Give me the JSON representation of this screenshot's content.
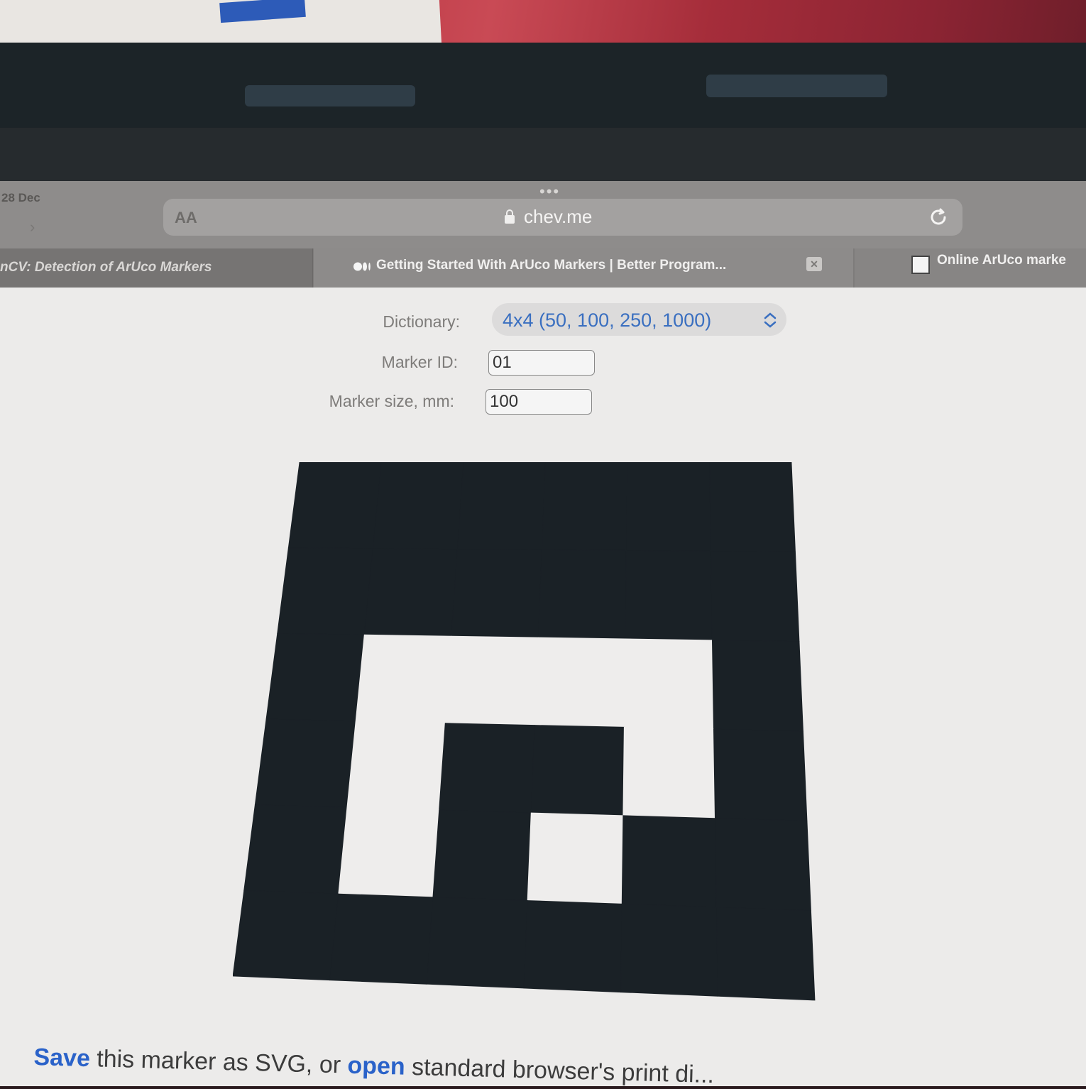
{
  "status": {
    "date": "28 Dec"
  },
  "browser": {
    "url": "chev.me",
    "text_size_label": "AA"
  },
  "tabs": [
    {
      "title": "nCV: Detection of ArUco Markers"
    },
    {
      "title": "Getting Started With ArUco Markers | Better Program..."
    },
    {
      "title": "Online ArUco marke"
    }
  ],
  "form": {
    "dictionary_label": "Dictionary:",
    "dictionary_value": "4x4 (50, 100, 250, 1000)",
    "marker_id_label": "Marker ID:",
    "marker_id_value": "01",
    "marker_size_label": "Marker size, mm:",
    "marker_size_value": "100"
  },
  "marker": {
    "grid_size": 6,
    "cells": [
      [
        1,
        1,
        1,
        1,
        1,
        1
      ],
      [
        1,
        1,
        1,
        1,
        1,
        1
      ],
      [
        1,
        0,
        0,
        0,
        0,
        1
      ],
      [
        1,
        0,
        1,
        1,
        0,
        1
      ],
      [
        1,
        0,
        1,
        0,
        1,
        1
      ],
      [
        1,
        1,
        1,
        1,
        1,
        1
      ]
    ],
    "black": "#1a2126",
    "white": "#eeedec"
  },
  "footer": {
    "save_link": "Save",
    "text_1": " this marker as SVG, or ",
    "open_link": "open",
    "text_2": " standard browser's print di..."
  },
  "colors": {
    "link": "#2a62c9",
    "select_text": "#3a6fc0"
  }
}
